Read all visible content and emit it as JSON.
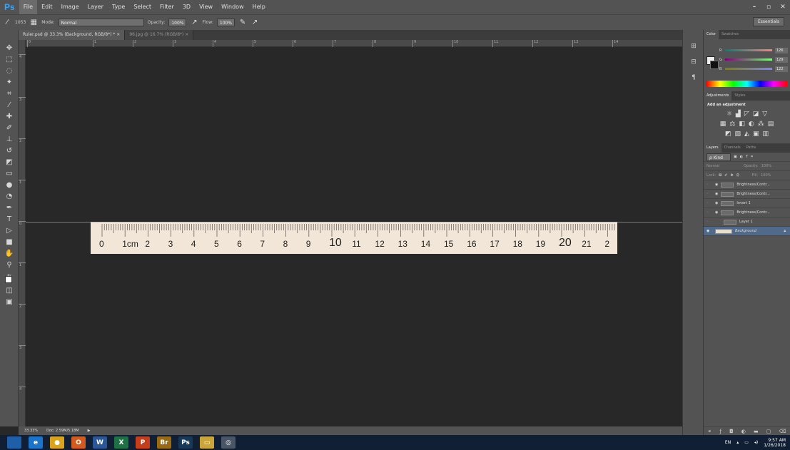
{
  "app": {
    "logo": "Ps"
  },
  "menu": [
    "File",
    "Edit",
    "Image",
    "Layer",
    "Type",
    "Select",
    "Filter",
    "3D",
    "View",
    "Window",
    "Help"
  ],
  "window_controls": [
    "–",
    "▫",
    "✕"
  ],
  "options": {
    "brush_size": "1053",
    "mode_label": "Mode:",
    "mode_value": "Normal",
    "opacity_label": "Opacity:",
    "opacity_value": "100%",
    "flow_label": "Flow:",
    "flow_value": "100%",
    "workspace": "Essentials"
  },
  "doc_tabs": [
    {
      "label": "Ruler.psd @ 33.3% (Background, RGB/8*) *  ×"
    },
    {
      "label": "96.jpg @ 16.7% (RGB/8*)  ×"
    }
  ],
  "ruler_numbers": [
    "0",
    "1",
    "2",
    "3",
    "4",
    "5",
    "6",
    "7",
    "8",
    "9",
    "10",
    "11",
    "12",
    "13",
    "14"
  ],
  "vruler_numbers": [
    "4",
    "3",
    "2",
    "1",
    "0",
    "1",
    "2",
    "3",
    "4"
  ],
  "ruler_image": {
    "labels": [
      "0",
      "1cm",
      "2",
      "3",
      "4",
      "5",
      "6",
      "7",
      "8",
      "9",
      "10",
      "11",
      "12",
      "13",
      "14",
      "15",
      "16",
      "17",
      "18",
      "19",
      "20",
      "21",
      "2"
    ]
  },
  "status": {
    "zoom": "33.33%",
    "doc": "Doc: 2.59M/5.18M",
    "arrow": "▶"
  },
  "color_panel": {
    "tabs": [
      "Color",
      "Swatches"
    ],
    "channels": [
      {
        "letter": "R",
        "value": "126",
        "gradient": "linear-gradient(90deg,#00807a,#ff807a)"
      },
      {
        "letter": "G",
        "value": "129",
        "gradient": "linear-gradient(90deg,#7e007a,#7eff7a)"
      },
      {
        "letter": "B",
        "value": "122",
        "gradient": "linear-gradient(90deg,#7e8100,#7e81ff)"
      }
    ]
  },
  "adjustments": {
    "tabs": [
      "Adjustments",
      "Styles"
    ],
    "title": "Add an adjustment"
  },
  "layers": {
    "tabs": [
      "Layers",
      "Channels",
      "Paths"
    ],
    "filter": "ρ Kind",
    "blend": "Normal",
    "opacity_label": "Opacity:",
    "opacity_value": "100%",
    "lock_label": "Lock:",
    "fill_label": "Fill:",
    "fill_value": "100%",
    "items": [
      {
        "name": "Brightness/Contr...",
        "selected": false
      },
      {
        "name": "Brightness/Contr...",
        "selected": false
      },
      {
        "name": "Invert 1",
        "selected": false
      },
      {
        "name": "Brightness/Contr...",
        "selected": false
      },
      {
        "name": "Layer 1",
        "selected": false
      },
      {
        "name": "Background",
        "selected": true
      }
    ]
  },
  "taskbar": {
    "apps": [
      {
        "label": "",
        "color": "#1f5fa8",
        "icon": "windows-icon"
      },
      {
        "label": "e",
        "color": "#1a74c9",
        "icon": "ie-icon"
      },
      {
        "label": "●",
        "color": "#d9a31b",
        "icon": "chrome-icon"
      },
      {
        "label": "O",
        "color": "#d35b1e",
        "icon": "outlook-icon"
      },
      {
        "label": "W",
        "color": "#2b5797",
        "icon": "word-icon"
      },
      {
        "label": "X",
        "color": "#1e7145",
        "icon": "excel-icon"
      },
      {
        "label": "P",
        "color": "#c43e1c",
        "icon": "powerpoint-icon"
      },
      {
        "label": "Br",
        "color": "#9a6a12",
        "icon": "bridge-icon"
      },
      {
        "label": "Ps",
        "color": "#16395a",
        "icon": "photoshop-icon"
      },
      {
        "label": "▭",
        "color": "#c9a53a",
        "icon": "folder-icon"
      },
      {
        "label": "◎",
        "color": "#4a5566",
        "icon": "media-icon"
      }
    ],
    "tray": {
      "lang": "EN",
      "time": "9:57 AM",
      "date": "1/26/2018"
    }
  }
}
